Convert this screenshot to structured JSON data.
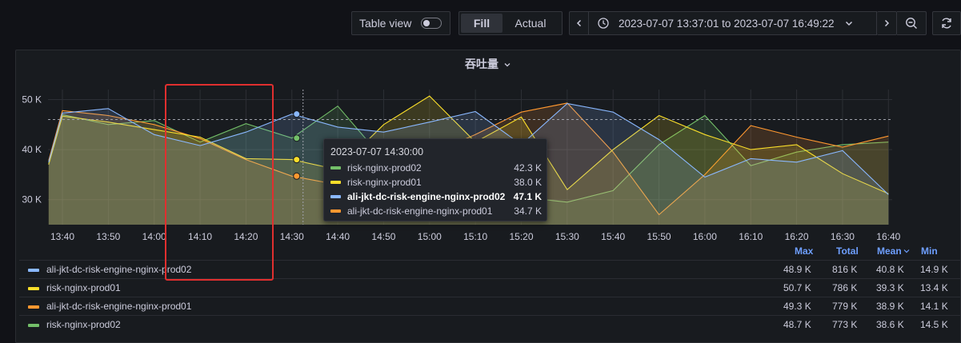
{
  "toolbar": {
    "table_view_label": "Table view",
    "fill_label": "Fill",
    "actual_label": "Actual",
    "time_range": "2023-07-07 13:37:01 to 2023-07-07 16:49:22"
  },
  "panel": {
    "title": "吞吐量"
  },
  "tooltip": {
    "time": "2023-07-07 14:30:00",
    "rows": [
      {
        "name": "risk-nginx-prod02",
        "value": "42.3 K",
        "color": "#73bf69",
        "bold": false
      },
      {
        "name": "risk-nginx-prod01",
        "value": "38.0 K",
        "color": "#fade2a",
        "bold": false
      },
      {
        "name": "ali-jkt-dc-risk-engine-nginx-prod02",
        "value": "47.1 K",
        "color": "#8ab8ff",
        "bold": true
      },
      {
        "name": "ali-jkt-dc-risk-engine-nginx-prod01",
        "value": "34.7 K",
        "color": "#ff9830",
        "bold": false
      }
    ]
  },
  "legend": {
    "headers": {
      "max": "Max",
      "total": "Total",
      "mean": "Mean",
      "min": "Min"
    },
    "rows": [
      {
        "name": "ali-jkt-dc-risk-engine-nginx-prod02",
        "color": "#8ab8ff",
        "max": "48.9 K",
        "total": "816 K",
        "mean": "40.8 K",
        "min": "14.9 K"
      },
      {
        "name": "risk-nginx-prod01",
        "color": "#fade2a",
        "max": "50.7 K",
        "total": "786 K",
        "mean": "39.3 K",
        "min": "13.4 K"
      },
      {
        "name": "ali-jkt-dc-risk-engine-nginx-prod01",
        "color": "#ff9830",
        "max": "49.3 K",
        "total": "779 K",
        "mean": "38.9 K",
        "min": "14.1 K"
      },
      {
        "name": "risk-nginx-prod02",
        "color": "#73bf69",
        "max": "48.7 K",
        "total": "773 K",
        "mean": "38.6 K",
        "min": "14.5 K"
      }
    ]
  },
  "chart_data": {
    "type": "area",
    "title": "吞吐量",
    "x": [
      "13:37",
      "13:40",
      "13:50",
      "14:00",
      "14:10",
      "14:20",
      "14:30",
      "14:40",
      "14:50",
      "15:00",
      "15:10",
      "15:20",
      "15:30",
      "15:40",
      "15:50",
      "16:00",
      "16:10",
      "16:20",
      "16:30",
      "16:40"
    ],
    "xticks": [
      "13:40",
      "13:50",
      "14:00",
      "14:10",
      "14:20",
      "14:30",
      "14:40",
      "14:50",
      "15:00",
      "15:10",
      "15:20",
      "15:30",
      "15:40",
      "15:50",
      "16:00",
      "16:10",
      "16:20",
      "16:30",
      "16:40"
    ],
    "yticks": [
      "30 K",
      "40 K",
      "50 K"
    ],
    "ylim": [
      25,
      52
    ],
    "series": [
      {
        "name": "ali-jkt-dc-risk-engine-nginx-prod02",
        "color": "#8ab8ff",
        "values": [
          37.5,
          47.3,
          48.2,
          43.0,
          40.8,
          43.5,
          47.1,
          44.5,
          43.5,
          45.5,
          47.6,
          41.0,
          49.2,
          47.5,
          42.0,
          34.5,
          38.2,
          37.5,
          39.8,
          31.0
        ]
      },
      {
        "name": "risk-nginx-prod01",
        "color": "#fade2a",
        "values": [
          37.0,
          46.7,
          45.5,
          44.0,
          42.5,
          38.2,
          38.0,
          36.0,
          45.0,
          50.7,
          41.5,
          46.5,
          32.0,
          40.0,
          46.8,
          43.0,
          40.0,
          41.0,
          35.2,
          31.2
        ]
      },
      {
        "name": "ali-jkt-dc-risk-engine-nginx-prod01",
        "color": "#ff9830",
        "values": [
          37.8,
          47.8,
          46.8,
          45.0,
          42.2,
          38.0,
          34.7,
          33.0,
          35.0,
          39.0,
          43.0,
          47.5,
          49.3,
          39.5,
          27.0,
          35.0,
          44.8,
          42.5,
          40.5,
          42.7
        ]
      },
      {
        "name": "risk-nginx-prod02",
        "color": "#73bf69",
        "values": [
          37.2,
          47.0,
          45.0,
          45.8,
          41.5,
          45.2,
          42.3,
          48.7,
          38.0,
          36.0,
          33.5,
          30.5,
          29.5,
          31.8,
          41.0,
          46.8,
          36.8,
          39.5,
          41.0,
          41.5
        ]
      }
    ],
    "hover_time": "14:30",
    "threshold_line": 46.0
  }
}
